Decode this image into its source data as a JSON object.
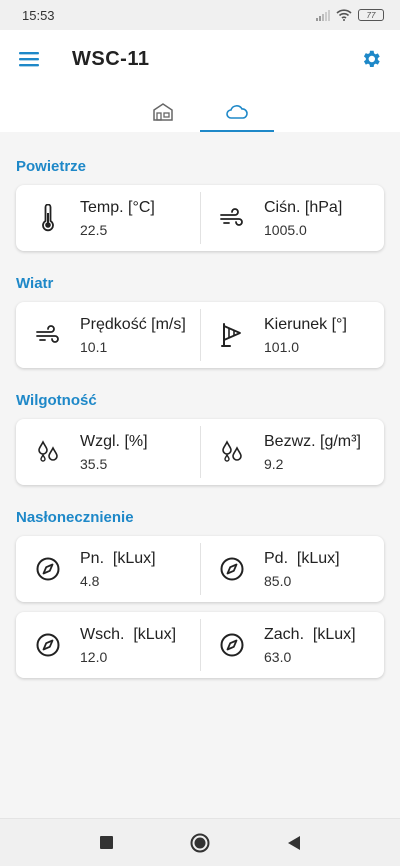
{
  "status": {
    "time": "15:53",
    "battery": "77"
  },
  "app": {
    "title": "WSC-11"
  },
  "colors": {
    "accent": "#1e88c8"
  },
  "tabs": [
    {
      "icon": "house-icon",
      "active": false
    },
    {
      "icon": "cloud-icon",
      "active": true
    }
  ],
  "sections": {
    "air": {
      "title": "Powietrze",
      "temp": {
        "label": "Temp. [°C]",
        "value": "22.5",
        "icon": "thermometer-icon"
      },
      "pressure": {
        "label": "Ciśn. [hPa]",
        "value": "1005.0",
        "icon": "wind-icon"
      }
    },
    "wind": {
      "title": "Wiatr",
      "speed": {
        "label": "Prędkość [m/s]",
        "value": "10.1",
        "icon": "wind-icon"
      },
      "direction": {
        "label": "Kierunek [°]",
        "value": "101.0",
        "icon": "wind-flag-icon"
      }
    },
    "humidity": {
      "title": "Wilgotność",
      "relative": {
        "label": "Wzgl. [%]",
        "value": "35.5",
        "icon": "droplets-icon"
      },
      "absolute": {
        "label": "Bezwz. [g/m³]",
        "value": "9.2",
        "icon": "droplets-icon"
      }
    },
    "sun": {
      "title": "Nasłonecznienie",
      "north": {
        "label": "Pn.  [kLux]",
        "value": "4.8",
        "icon": "compass-icon"
      },
      "south": {
        "label": "Pd.  [kLux]",
        "value": "85.0",
        "icon": "compass-icon"
      },
      "east": {
        "label": "Wsch.  [kLux]",
        "value": "12.0",
        "icon": "compass-icon"
      },
      "west": {
        "label": "Zach.  [kLux]",
        "value": "63.0",
        "icon": "compass-icon"
      }
    }
  }
}
